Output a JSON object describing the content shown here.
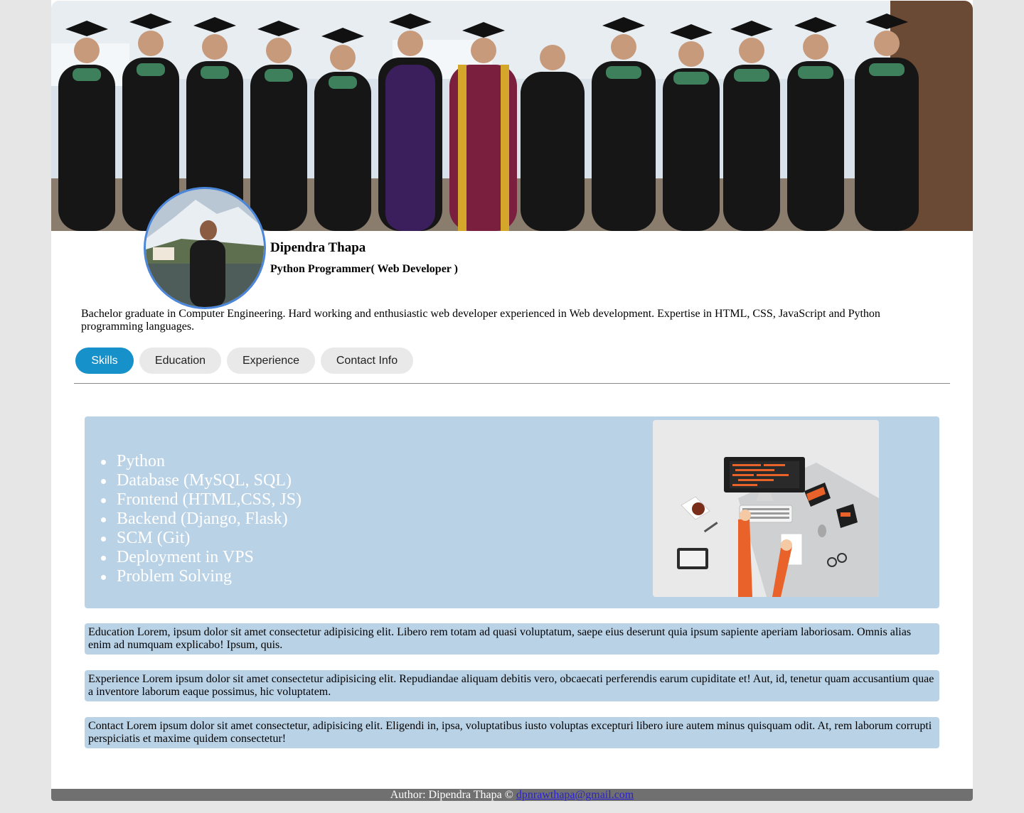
{
  "profile": {
    "name": "Dipendra Thapa",
    "role": "Python Programmer( Web Developer )",
    "bio": "Bachelor graduate in Computer Engineering. Hard working and enthusiastic web developer experienced in Web development. Expertise in HTML, CSS, JavaScript and Python programming languages."
  },
  "tabs": [
    {
      "label": "Skills",
      "active": true
    },
    {
      "label": "Education",
      "active": false
    },
    {
      "label": "Experience",
      "active": false
    },
    {
      "label": "Contact Info",
      "active": false
    }
  ],
  "skills": [
    "Python",
    "Database (MySQL, SQL)",
    "Frontend (HTML,CSS, JS)",
    "Backend (Django, Flask)",
    "SCM (Git)",
    "Deployment in VPS",
    "Problem Solving"
  ],
  "sections": {
    "education": "Education Lorem, ipsum dolor sit amet consectetur adipisicing elit. Libero rem totam ad quasi voluptatum, saepe eius deserunt quia ipsum sapiente aperiam laboriosam. Omnis alias enim ad numquam explicabo! Ipsum, quis.",
    "experience": "Experience Lorem ipsum dolor sit amet consectetur adipisicing elit. Repudiandae aliquam debitis vero, obcaecati perferendis earum cupiditate et! Aut, id, tenetur quam accusantium quae a inventore laborum eaque possimus, hic voluptatem.",
    "contact": "Contact Lorem ipsum dolor sit amet consectetur, adipisicing elit. Eligendi in, ipsa, voluptatibus iusto voluptas excepturi libero iure autem minus quisquam odit. At, rem laborum corrupti perspiciatis et maxime quidem consectetur!"
  },
  "footer": {
    "author_text": "Author: Dipendra Thapa ©",
    "email": "dpnrawthapa@gmail.com"
  },
  "colors": {
    "accent": "#1691c9",
    "panel": "#bad2e6",
    "avatar_border": "#4a86d9",
    "footer": "#707070"
  }
}
